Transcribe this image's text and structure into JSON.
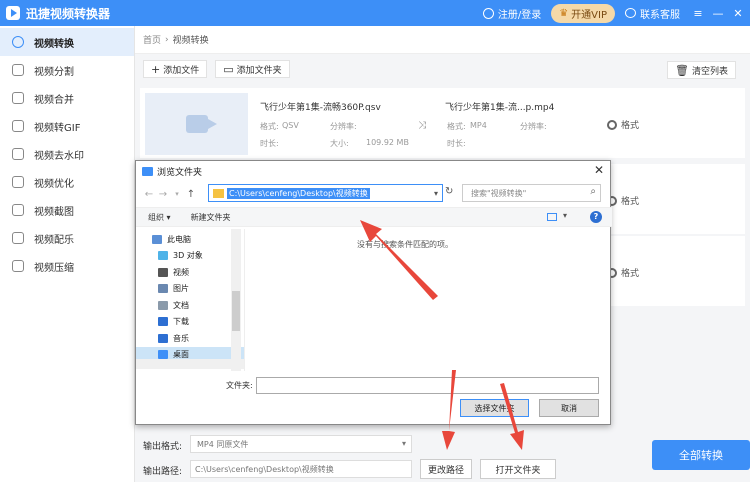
{
  "app": {
    "title": "迅捷视频转换器"
  },
  "titlebar": {
    "login": "注册/登录",
    "vip": "开通VIP",
    "service": "联系客服"
  },
  "sidebar": {
    "items": [
      {
        "label": "视频转换"
      },
      {
        "label": "视频分割"
      },
      {
        "label": "视频合并"
      },
      {
        "label": "视频转GIF"
      },
      {
        "label": "视频去水印"
      },
      {
        "label": "视频优化"
      },
      {
        "label": "视频截图"
      },
      {
        "label": "视频配乐"
      },
      {
        "label": "视频压缩"
      }
    ]
  },
  "breadcrumb": {
    "home": "首页",
    "current": "视频转换"
  },
  "toolbar": {
    "add_file": "添加文件",
    "add_folder": "添加文件夹",
    "clear": "清空列表"
  },
  "file": {
    "source_name": "飞行少年第1集-流畅360P.qsv",
    "target_name": "飞行少年第1集-流...p.mp4",
    "fmt_label": "格式:",
    "fmt_src": "QSV",
    "fmt_dst": "MP4",
    "res_label": "分辨率:",
    "dur_label": "时长:",
    "size_label": "大小:",
    "size": "109.92 MB",
    "format_btn": "格式"
  },
  "extra_cards": {
    "format_btn": "格式"
  },
  "bottom": {
    "output_format_label": "输出格式:",
    "output_format_value": "MP4 同原文件",
    "output_path_label": "输出路径:",
    "output_path_value": "C:\\Users\\cenfeng\\Desktop\\视频转换",
    "change_path": "更改路径",
    "open_folder": "打开文件夹",
    "convert_all": "全部转换"
  },
  "dialog": {
    "title": "浏览文件夹",
    "address": "C:\\Users\\cenfeng\\Desktop\\视频转换",
    "search_placeholder": "搜索\"视频转换\"",
    "organize": "组织 ▾",
    "new_folder": "新建文件夹",
    "empty_text": "没有与搜索条件匹配的项。",
    "tree": [
      {
        "label": "此电脑",
        "color": "#5a8fd6"
      },
      {
        "label": "3D 对象",
        "color": "#4fb3e8"
      },
      {
        "label": "视频",
        "color": "#555555"
      },
      {
        "label": "图片",
        "color": "#6a88b0"
      },
      {
        "label": "文档",
        "color": "#8a9aaa"
      },
      {
        "label": "下载",
        "color": "#2d6fd2"
      },
      {
        "label": "音乐",
        "color": "#2d6fd2"
      },
      {
        "label": "桌面",
        "color": "#3d8ff7"
      }
    ],
    "folder_label": "文件夹:",
    "select_btn": "选择文件夹",
    "cancel_btn": "取消"
  },
  "colors": {
    "accent": "#3d8ff7",
    "arrow": "#e8473b"
  }
}
